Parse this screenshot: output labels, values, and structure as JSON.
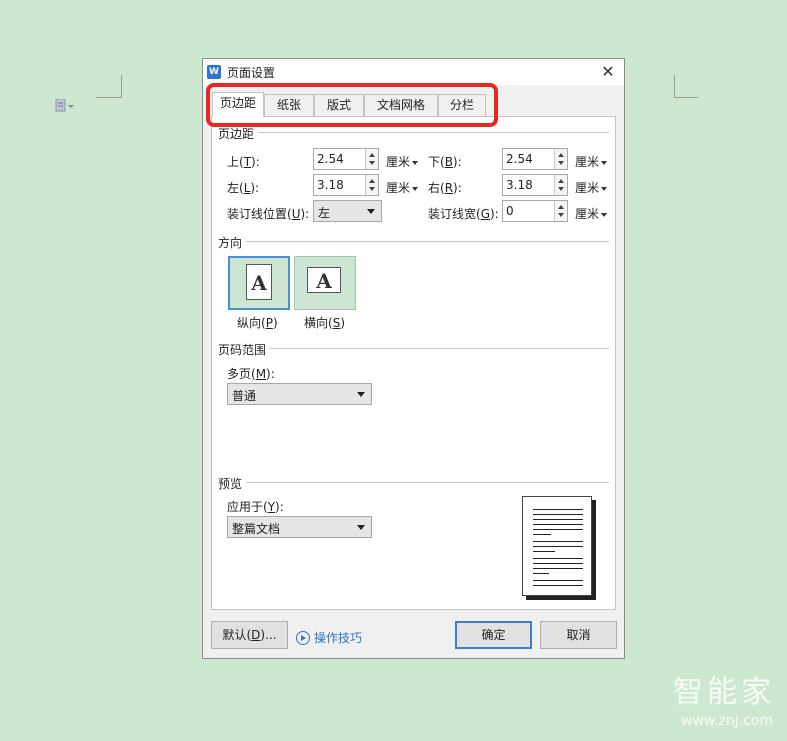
{
  "watermark": {
    "logo": "智能家",
    "url": "www.znj.com"
  },
  "dialog": {
    "title": "页面设置",
    "app_icon": "W",
    "close_glyph": "✕",
    "tabs": [
      {
        "label": "页边距",
        "active": true
      },
      {
        "label": "纸张",
        "active": false
      },
      {
        "label": "版式",
        "active": false
      },
      {
        "label": "文档网格",
        "active": false
      },
      {
        "label": "分栏",
        "active": false
      }
    ],
    "margins": {
      "section": "页边距",
      "top": {
        "label": "上(",
        "key": "T",
        "end": "):",
        "value": "2.54",
        "unit": "厘米"
      },
      "bottom": {
        "label": "下(",
        "key": "B",
        "end": "):",
        "value": "2.54",
        "unit": "厘米"
      },
      "left": {
        "label": "左(",
        "key": "L",
        "end": "):",
        "value": "3.18",
        "unit": "厘米"
      },
      "right": {
        "label": "右(",
        "key": "R",
        "end": "):",
        "value": "3.18",
        "unit": "厘米"
      },
      "gutter_pos": {
        "label": "装订线位置(",
        "key": "U",
        "end": "):",
        "value": "左"
      },
      "gutter_width": {
        "label": "装订线宽(",
        "key": "G",
        "end": "):",
        "value": "0",
        "unit": "厘米"
      }
    },
    "orientation": {
      "section": "方向",
      "letter": "A",
      "portrait": {
        "label": "纵向(",
        "key": "P",
        "end": ")",
        "selected": true
      },
      "landscape": {
        "label": "横向(",
        "key": "S",
        "end": ")",
        "selected": false
      }
    },
    "page_range": {
      "section": "页码范围",
      "multi": {
        "label": "多页(",
        "key": "M",
        "end": "):",
        "value": "普通"
      }
    },
    "preview": {
      "section": "预览",
      "apply": {
        "label": "应用于(",
        "key": "Y",
        "end": "):",
        "value": "整篇文档"
      }
    },
    "buttons": {
      "default": {
        "label": "默认(",
        "key": "D",
        "end": ")..."
      },
      "tips": "操作技巧",
      "ok": "确定",
      "cancel": "取消"
    },
    "colors": {
      "highlight": "#e8281f",
      "accent": "#3a7fd5",
      "link": "#2f72c8"
    }
  }
}
